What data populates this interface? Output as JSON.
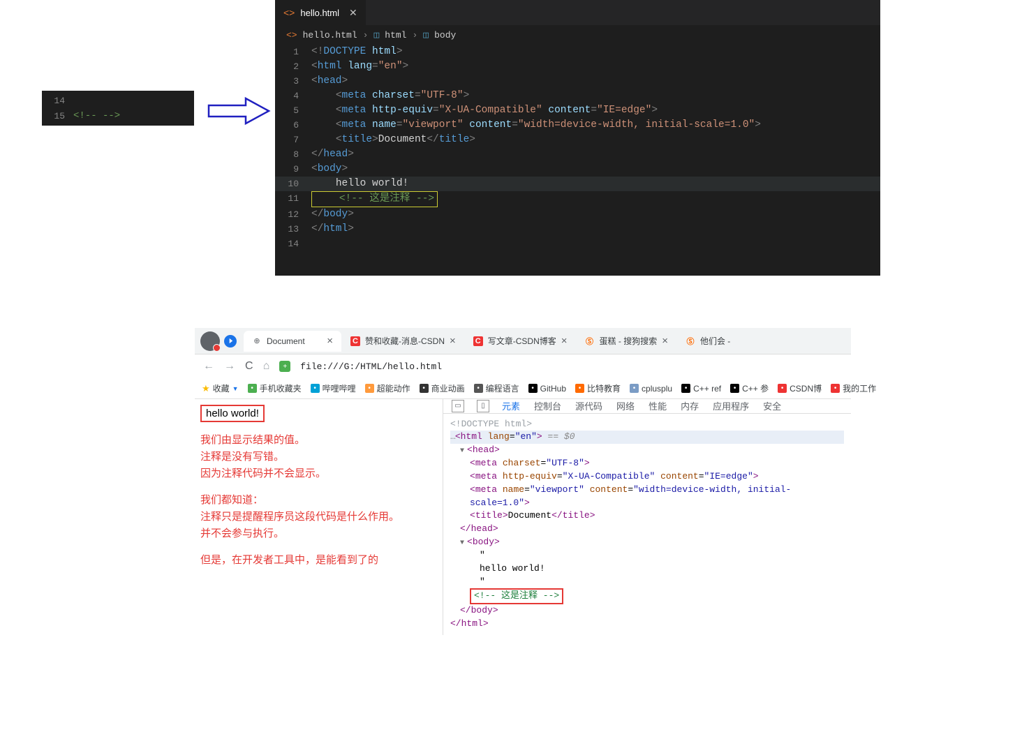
{
  "snippet": {
    "lines": [
      {
        "num": "14",
        "html": ""
      },
      {
        "num": "15",
        "html": "<span class='c-comment'>&lt;!--  --&gt;</span>"
      }
    ]
  },
  "vscode": {
    "tab_name": "hello.html",
    "breadcrumb": [
      "hello.html",
      "html",
      "body"
    ],
    "lines": [
      {
        "n": "1",
        "html": "<span class='c-punc'>&lt;!</span><span class='c-doctype'>DOCTYPE</span> <span class='c-attr'>html</span><span class='c-punc'>&gt;</span>"
      },
      {
        "n": "2",
        "html": "<span class='c-punc'>&lt;</span><span class='c-tag'>html</span> <span class='c-attr'>lang</span><span class='c-punc'>=</span><span class='c-str'>\"en\"</span><span class='c-punc'>&gt;</span>"
      },
      {
        "n": "3",
        "html": "<span class='c-punc'>&lt;</span><span class='c-tag'>head</span><span class='c-punc'>&gt;</span>"
      },
      {
        "n": "4",
        "html": "    <span class='c-punc'>&lt;</span><span class='c-tag'>meta</span> <span class='c-attr'>charset</span><span class='c-punc'>=</span><span class='c-str'>\"UTF-8\"</span><span class='c-punc'>&gt;</span>"
      },
      {
        "n": "5",
        "html": "    <span class='c-punc'>&lt;</span><span class='c-tag'>meta</span> <span class='c-attr'>http-equiv</span><span class='c-punc'>=</span><span class='c-str'>\"X-UA-Compatible\"</span> <span class='c-attr'>content</span><span class='c-punc'>=</span><span class='c-str'>\"IE=edge\"</span><span class='c-punc'>&gt;</span>"
      },
      {
        "n": "6",
        "html": "    <span class='c-punc'>&lt;</span><span class='c-tag'>meta</span> <span class='c-attr'>name</span><span class='c-punc'>=</span><span class='c-str'>\"viewport\"</span> <span class='c-attr'>content</span><span class='c-punc'>=</span><span class='c-str'>\"width=device-width, initial-scale=1.0\"</span><span class='c-punc'>&gt;</span>"
      },
      {
        "n": "7",
        "html": "    <span class='c-punc'>&lt;</span><span class='c-tag'>title</span><span class='c-punc'>&gt;</span><span class='c-text'>Document</span><span class='c-punc'>&lt;/</span><span class='c-tag'>title</span><span class='c-punc'>&gt;</span>"
      },
      {
        "n": "8",
        "html": "<span class='c-punc'>&lt;/</span><span class='c-tag'>head</span><span class='c-punc'>&gt;</span>"
      },
      {
        "n": "9",
        "html": "<span class='c-punc'>&lt;</span><span class='c-tag'>body</span><span class='c-punc'>&gt;</span>"
      },
      {
        "n": "10",
        "hl": true,
        "html": "    <span class='c-text'>hello world!</span>"
      },
      {
        "n": "11",
        "box": true,
        "html": "    <span class='c-comment'>&lt;!-- 这是注释 --&gt;</span>"
      },
      {
        "n": "12",
        "html": "<span class='c-punc'>&lt;/</span><span class='c-tag'>body</span><span class='c-punc'>&gt;</span>"
      },
      {
        "n": "13",
        "html": "<span class='c-punc'>&lt;/</span><span class='c-tag'>html</span><span class='c-punc'>&gt;</span>"
      },
      {
        "n": "14",
        "html": ""
      }
    ]
  },
  "browser": {
    "tabs": [
      {
        "title": "Document",
        "fav": "globe",
        "active": true
      },
      {
        "title": "赞和收藏-消息-CSDN",
        "fav": "c"
      },
      {
        "title": "写文章-CSDN博客",
        "fav": "c"
      },
      {
        "title": "蛋糕 - 搜狗搜索",
        "fav": "s"
      },
      {
        "title": "他们会 -",
        "fav": "s",
        "partial": true
      }
    ],
    "url": "file:///G:/HTML/hello.html",
    "bookmarks_label": "收藏",
    "bookmarks": [
      {
        "label": "手机收藏夹",
        "color": "#4caf50"
      },
      {
        "label": "哔哩哔哩",
        "color": "#00a1d6"
      },
      {
        "label": "超能动作",
        "color": "#ff9a3c"
      },
      {
        "label": "商业动画",
        "color": "#333"
      },
      {
        "label": "编程语言",
        "color": "#555"
      },
      {
        "label": "GitHub",
        "color": "#000"
      },
      {
        "label": "比特教育",
        "color": "#ff6a00"
      },
      {
        "label": "cplusplu",
        "color": "#7b9cc5"
      },
      {
        "label": "C++ ref",
        "color": "#000"
      },
      {
        "label": "C++ 参",
        "color": "#000"
      },
      {
        "label": "CSDN博",
        "color": "#e33"
      },
      {
        "label": "我的工作",
        "color": "#e33"
      }
    ],
    "page": {
      "hello": "hello world!",
      "para1": "我们由显示结果的值。\n注释是没有写错。\n因为注释代码并不会显示。",
      "para2": "我们都知道：\n注释只是提醒程序员这段代码是什么作用。\n并不会参与执行。",
      "para3": "但是，在开发者工具中，是能看到了的"
    },
    "devtools": {
      "tabs": [
        "元素",
        "控制台",
        "源代码",
        "网络",
        "性能",
        "内存",
        "应用程序",
        "安全"
      ],
      "active_tab": "元素",
      "lines": [
        {
          "cls": "",
          "html": "<span class='l-doctype'>&lt;!DOCTYPE html&gt;</span>"
        },
        {
          "cls": "l-selrow",
          "html": "<span class='dots'>…</span><span class='l-punc'>&lt;</span><span class='l-tag'>html</span> <span class='l-attr'>lang</span>=<span class='l-str'>\"en\"</span><span class='l-punc'>&gt;</span> <span class='eq80'>== $0</span>"
        },
        {
          "cls": "ind1",
          "html": "<span class='tri'>▼</span><span class='l-punc'>&lt;</span><span class='l-tag'>head</span><span class='l-punc'>&gt;</span>"
        },
        {
          "cls": "ind2",
          "html": "<span class='l-punc'>&lt;</span><span class='l-tag'>meta</span> <span class='l-attr'>charset</span>=<span class='l-str'>\"UTF-8\"</span><span class='l-punc'>&gt;</span>"
        },
        {
          "cls": "ind2",
          "html": "<span class='l-punc'>&lt;</span><span class='l-tag'>meta</span> <span class='l-attr'>http-equiv</span>=<span class='l-str'>\"X-UA-Compatible\"</span> <span class='l-attr'>content</span>=<span class='l-str'>\"IE=edge\"</span><span class='l-punc'>&gt;</span>"
        },
        {
          "cls": "ind2",
          "html": "<span class='l-punc'>&lt;</span><span class='l-tag'>meta</span> <span class='l-attr'>name</span>=<span class='l-str'>\"viewport\"</span> <span class='l-attr'>content</span>=<span class='l-str'>\"width=device-width, initial-scale=1.0\"</span><span class='l-punc'>&gt;</span>"
        },
        {
          "cls": "ind2",
          "html": "<span class='l-punc'>&lt;</span><span class='l-tag'>title</span><span class='l-punc'>&gt;</span>Document<span class='l-punc'>&lt;/</span><span class='l-tag'>title</span><span class='l-punc'>&gt;</span>"
        },
        {
          "cls": "ind1",
          "html": "<span class='l-punc'>&lt;/</span><span class='l-tag'>head</span><span class='l-punc'>&gt;</span>"
        },
        {
          "cls": "ind1",
          "html": "<span class='tri'>▼</span><span class='l-punc'>&lt;</span><span class='l-tag'>body</span><span class='l-punc'>&gt;</span>"
        },
        {
          "cls": "ind3",
          "html": "\""
        },
        {
          "cls": "ind3",
          "html": "hello world!"
        },
        {
          "cls": "ind3",
          "html": "\""
        },
        {
          "cls": "ind2",
          "box": true,
          "html": "<span class='l-comment'>&lt;!-- 这是注释 --&gt;</span>"
        },
        {
          "cls": "ind1",
          "html": "<span class='l-punc'>&lt;/</span><span class='l-tag'>body</span><span class='l-punc'>&gt;</span>"
        },
        {
          "cls": "",
          "html": "<span class='l-punc'>&lt;/</span><span class='l-tag'>html</span><span class='l-punc'>&gt;</span>"
        }
      ]
    }
  }
}
